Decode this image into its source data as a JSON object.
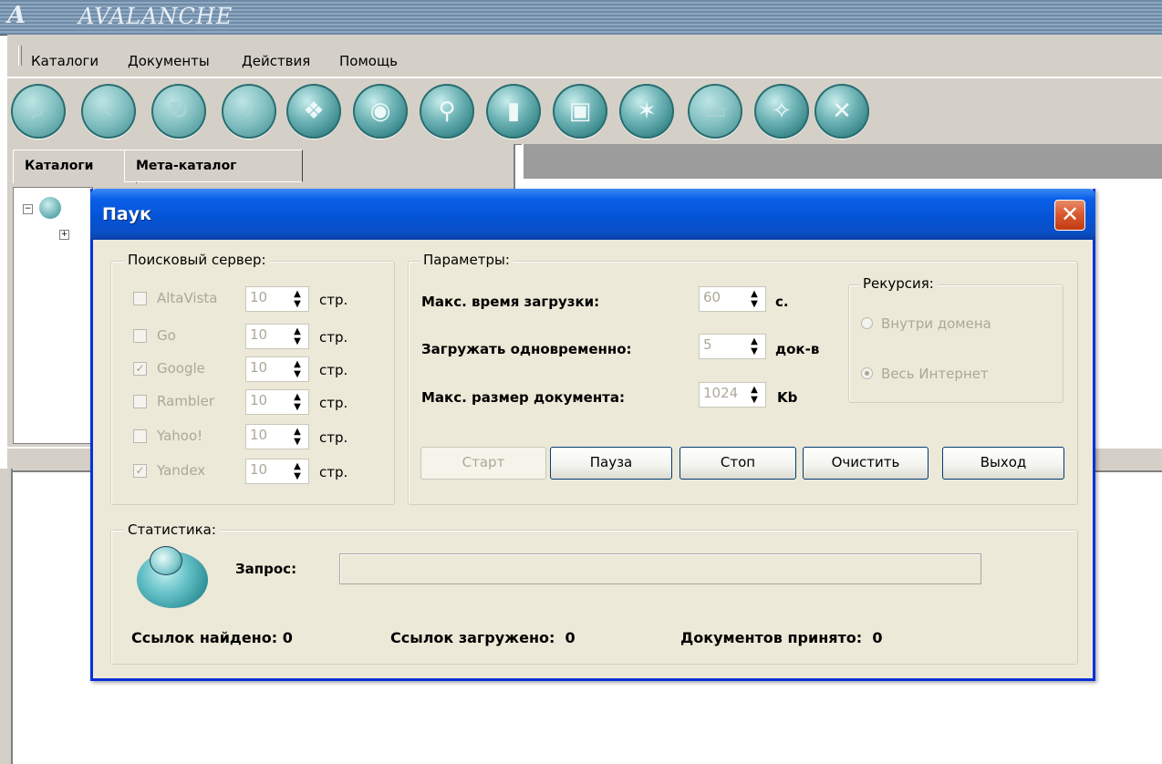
{
  "app": {
    "logo_letter": "A",
    "title": "AVALANCHE"
  },
  "menu": [
    "Каталоги",
    "Документы",
    "Действия",
    "Помощь"
  ],
  "toolbar_icons": [
    "search-icon",
    "back-icon",
    "refresh-icon",
    "forward-icon",
    "catalog-icon",
    "disc-icon",
    "find-icon",
    "clipboard-icon",
    "document-icon",
    "spider-icon",
    "package-icon",
    "wand-icon",
    "close-icon"
  ],
  "left_tabs": [
    "Каталоги",
    "Мета-каталог"
  ],
  "dialog": {
    "title": "Паук",
    "search_server": {
      "legend": "Поисковый сервер:",
      "engines": [
        {
          "name": "AltaVista",
          "checked": false,
          "pages": "10",
          "unit": "стр."
        },
        {
          "name": "Go",
          "checked": false,
          "pages": "10",
          "unit": "стр."
        },
        {
          "name": "Google",
          "checked": true,
          "pages": "10",
          "unit": "стр."
        },
        {
          "name": "Rambler",
          "checked": false,
          "pages": "10",
          "unit": "стр."
        },
        {
          "name": "Yahoo!",
          "checked": false,
          "pages": "10",
          "unit": "стр."
        },
        {
          "name": "Yandex",
          "checked": true,
          "pages": "10",
          "unit": "стр."
        }
      ]
    },
    "params": {
      "legend": "Параметры:",
      "max_load_time_label": "Макс. время загрузки:",
      "max_load_time_value": "60",
      "max_load_time_unit": "с.",
      "concurrent_label": "Загружать одновременно:",
      "concurrent_value": "5",
      "concurrent_unit": "док-в",
      "max_size_label": "Макс. размер документа:",
      "max_size_value": "1024",
      "max_size_unit": "Kb"
    },
    "recursion": {
      "legend": "Рекурсия:",
      "options": [
        "Внутри домена",
        "Весь Интернет"
      ],
      "selected": "Весь Интернет"
    },
    "buttons": {
      "start": "Старт",
      "pause": "Пауза",
      "stop": "Стоп",
      "clear": "Очистить",
      "exit": "Выход"
    },
    "stats": {
      "legend": "Статистика:",
      "query_label": "Запрос:",
      "query_value": "",
      "links_found": "Ссылок найдено: 0",
      "links_loaded": "Ссылок загружено:  0",
      "docs_accepted": "Документов принято:  0"
    }
  }
}
